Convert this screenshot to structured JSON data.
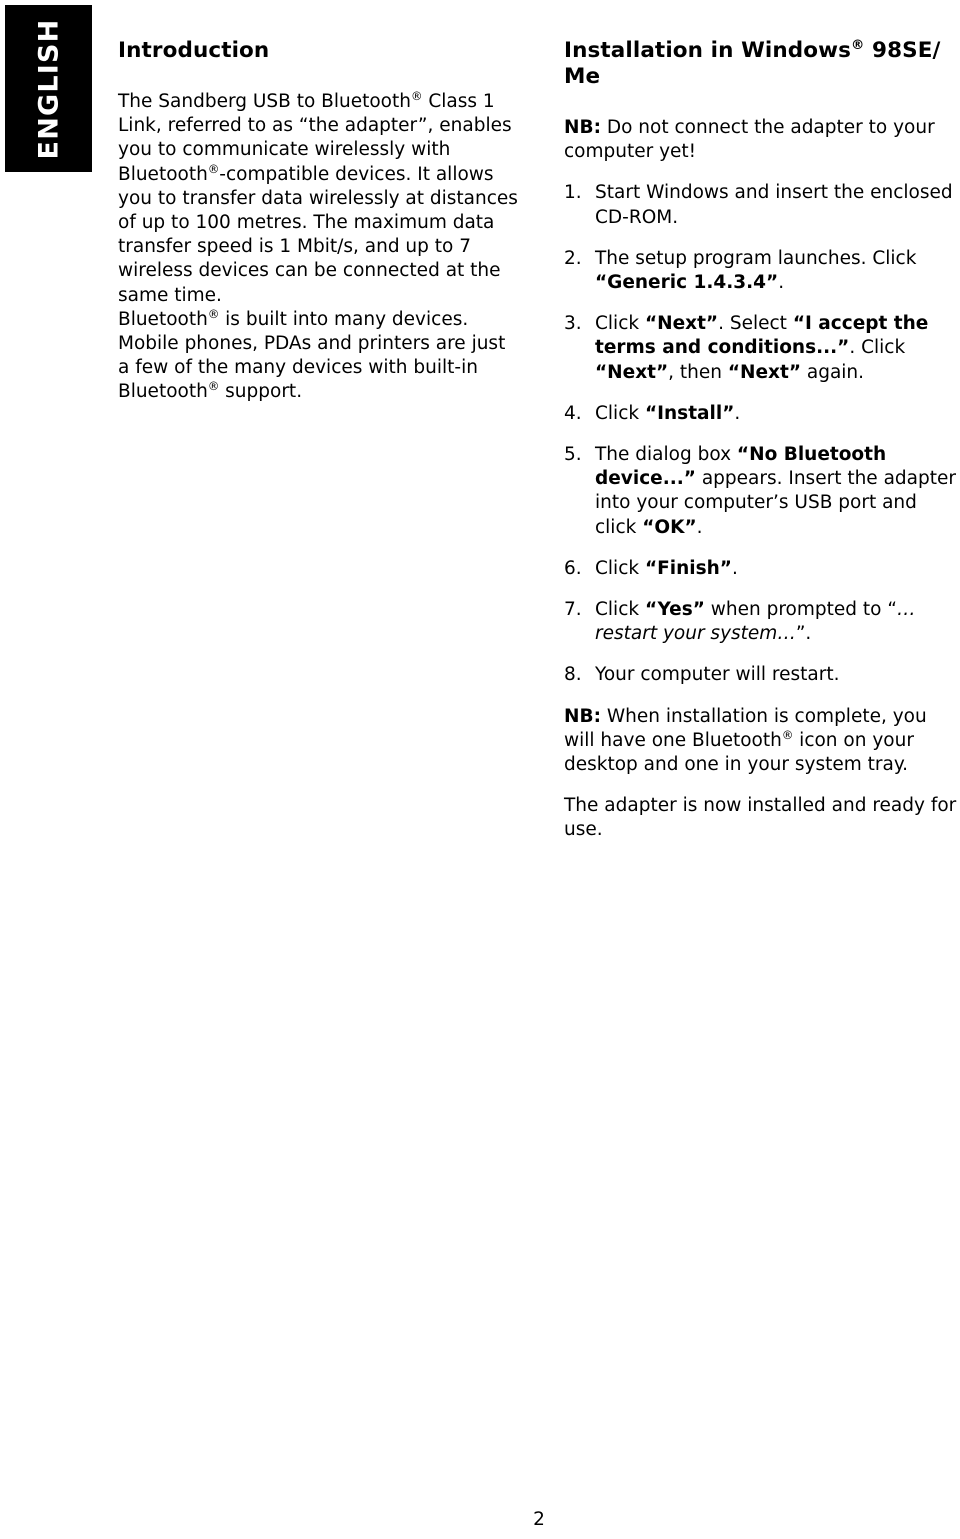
{
  "page": {
    "language_tab": "ENGLISH",
    "page_number": "2",
    "background_color": "#ffffff",
    "text_color": "#000000",
    "tab_background_color": "#000000",
    "tab_text_color": "#ffffff"
  },
  "left_column": {
    "heading": "Introduction",
    "paragraph_1_parts": {
      "a": "The Sandberg USB to Bluetooth",
      "reg1": "®",
      "b": " Class 1 Link, referred to as “the adapter”, enables you to communicate wirelessly with Bluetooth",
      "reg2": "®",
      "c": "-compatible devices. It allows you to transfer data wirelessly at distances of up to 100 metres. The maximum data transfer speed is 1 Mbit/s, and up to 7 wireless devices can be connected at the same time."
    },
    "paragraph_2_parts": {
      "a": "Bluetooth",
      "reg1": "®",
      "b": " is built into many devices. Mobile phones, PDAs and printers are just a few of the many devices with built-in Bluetooth",
      "reg2": "®",
      "c": " support."
    }
  },
  "right_column": {
    "heading_parts": {
      "a": "Installation in Windows",
      "reg": "®",
      "b": " 98SE/ Me"
    },
    "note_top": {
      "label": "NB:",
      "text": " Do not connect the adapter to your computer yet!"
    },
    "steps": [
      {
        "number": "1.",
        "parts": [
          {
            "style": "normal",
            "text": "Start Windows and insert the enclosed CD-ROM."
          }
        ]
      },
      {
        "number": "2.",
        "parts": [
          {
            "style": "normal",
            "text": "The setup program launches. Click "
          },
          {
            "style": "bold",
            "text": "“Generic 1.4.3.4”"
          },
          {
            "style": "normal",
            "text": "."
          }
        ]
      },
      {
        "number": "3.",
        "parts": [
          {
            "style": "normal",
            "text": "Click "
          },
          {
            "style": "bold",
            "text": "“Next”"
          },
          {
            "style": "normal",
            "text": ". Select "
          },
          {
            "style": "bold",
            "text": "“I accept the terms and conditions...”"
          },
          {
            "style": "normal",
            "text": ". Click "
          },
          {
            "style": "bold",
            "text": "“Next”"
          },
          {
            "style": "normal",
            "text": ", then "
          },
          {
            "style": "bold",
            "text": "“Next”"
          },
          {
            "style": "normal",
            "text": " again."
          }
        ]
      },
      {
        "number": "4.",
        "parts": [
          {
            "style": "normal",
            "text": "Click "
          },
          {
            "style": "bold",
            "text": "“Install”"
          },
          {
            "style": "normal",
            "text": "."
          }
        ]
      },
      {
        "number": "5.",
        "parts": [
          {
            "style": "normal",
            "text": "The dialog box "
          },
          {
            "style": "bold",
            "text": "“No Bluetooth device...”"
          },
          {
            "style": "normal",
            "text": " appears. Insert the adapter into your computer’s USB port and click "
          },
          {
            "style": "bold",
            "text": "“OK”"
          },
          {
            "style": "normal",
            "text": "."
          }
        ]
      },
      {
        "number": "6.",
        "parts": [
          {
            "style": "normal",
            "text": "Click "
          },
          {
            "style": "bold",
            "text": "“Finish”"
          },
          {
            "style": "normal",
            "text": "."
          }
        ]
      },
      {
        "number": "7.",
        "parts": [
          {
            "style": "normal",
            "text": "Click "
          },
          {
            "style": "bold",
            "text": "“Yes”"
          },
          {
            "style": "normal",
            "text": " when prompted to “"
          },
          {
            "style": "italic",
            "text": "…restart your system…"
          },
          {
            "style": "normal",
            "text": "”."
          }
        ]
      },
      {
        "number": "8.",
        "parts": [
          {
            "style": "normal",
            "text": "Your computer will restart."
          }
        ]
      }
    ],
    "note_bottom": {
      "label": "NB:",
      "text_a": " When installation is complete, you will have one Bluetooth",
      "reg": "®",
      "text_b": " icon on your desktop and one in your system tray."
    },
    "closing_paragraph": "The adapter is now installed and ready for use."
  }
}
